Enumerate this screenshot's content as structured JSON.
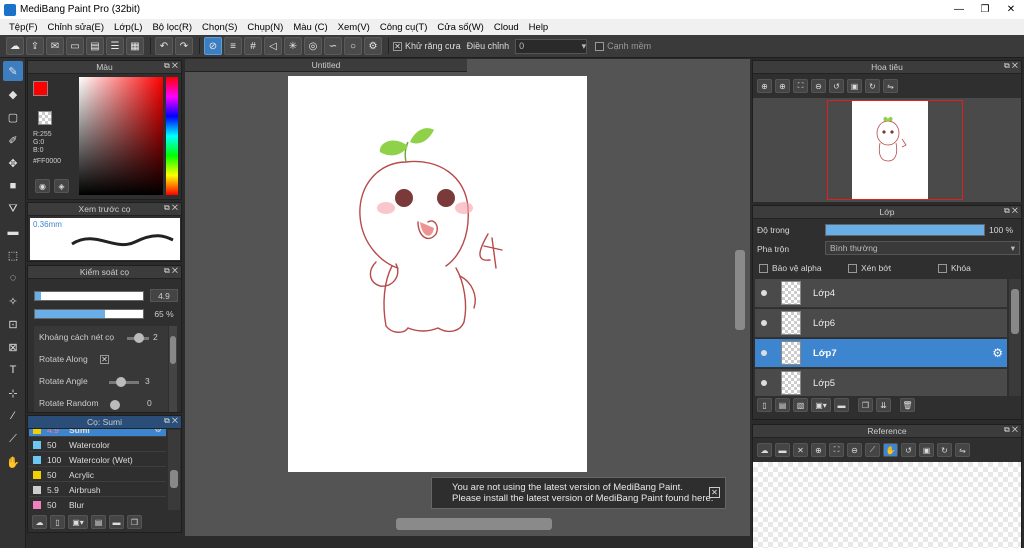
{
  "window": {
    "title": "MediBang Paint Pro (32bit)",
    "min": "—",
    "max": "❐",
    "close": "✕"
  },
  "menu": [
    "Tệp(F)",
    "Chỉnh sửa(E)",
    "Lớp(L)",
    "Bộ lọc(R)",
    "Chọn(S)",
    "Chụp(N)",
    "Màu (C)",
    "Xem(V)",
    "Công cụ(T)",
    "Cửa số(W)",
    "Cloud",
    "Help"
  ],
  "toolbar": {
    "antialias_label": "Khử răng cưa",
    "adjust_label": "Điều chỉnh",
    "adjust_value": "0",
    "soft_edge_label": "Cạnh mềm"
  },
  "color_panel": {
    "title": "Màu",
    "foreground": "#ff0000",
    "r": "R:255",
    "g": "G:0",
    "b": "B:0",
    "hex": "#FF0000"
  },
  "preview_panel": {
    "title": "Xem trước cọ",
    "size_label": "0.36mm"
  },
  "brush_control": {
    "title": "Kiểm soát cọ",
    "size_value": "4.9",
    "size_fraction": 0.06,
    "opacity_value": "65 %",
    "opacity_fraction": 0.65,
    "spacing_label": "Khoảng cách nét cọ",
    "spacing_value": "2",
    "rotate_along_label": "Rotate Along",
    "rotate_angle_label": "Rotate Angle",
    "rotate_angle_value": "3",
    "rotate_random_label": "Rotate Random",
    "rotate_random_value": "0"
  },
  "brush_list": {
    "title": "Cọ: Sumi",
    "items": [
      {
        "size": "4.9",
        "name": "Sumi",
        "color": "#f0d000",
        "selected": true
      },
      {
        "size": "50",
        "name": "Watercolor",
        "color": "#6cc8f0"
      },
      {
        "size": "100",
        "name": "Watercolor (Wet)",
        "color": "#6cc8f0"
      },
      {
        "size": "50",
        "name": "Acrylic",
        "color": "#f0d000"
      },
      {
        "size": "5.9",
        "name": "Airbrush",
        "color": "#cccccc"
      },
      {
        "size": "50",
        "name": "Blur",
        "color": "#f080c0"
      }
    ]
  },
  "document": {
    "tab_title": "Untitled"
  },
  "notice": {
    "line1": "You are not using the latest version of MediBang Paint.",
    "line2": "Please install the latest version of MediBang Paint found here."
  },
  "navigator": {
    "title": "Hoa tiêu"
  },
  "layers": {
    "title": "Lớp",
    "opacity_label": "Độ trong",
    "opacity_value": "100 %",
    "opacity_fraction": 1.0,
    "blend_label": "Pha trộn",
    "blend_value": "Bình thường",
    "protect_alpha": "Bảo vệ alpha",
    "clipping": "Xén bớt",
    "lock": "Khóa",
    "items": [
      {
        "name": "Lớp4",
        "selected": false
      },
      {
        "name": "Lớp6",
        "selected": false
      },
      {
        "name": "Lớp7",
        "selected": true
      },
      {
        "name": "Lớp5",
        "selected": false
      }
    ]
  },
  "reference": {
    "title": "Reference"
  },
  "colors": {
    "accent": "#3d86cf",
    "panel": "#2f2f2f",
    "canvas_bg": "#545454"
  }
}
